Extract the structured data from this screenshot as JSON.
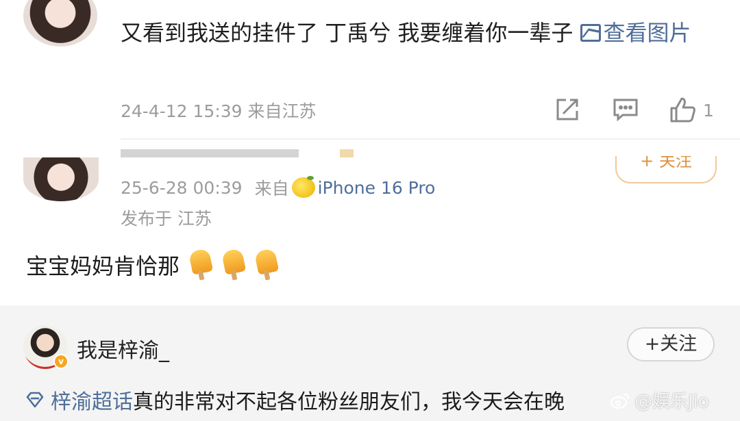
{
  "comment1": {
    "text": "又看到我送的挂件了 丁禹兮 我要缠着你一辈子 ",
    "view_image_label": "查看图片",
    "meta": "24-4-12 15:39  来自江苏",
    "like_count": "1",
    "icons": [
      "share-icon",
      "comment-icon",
      "like-icon",
      "image-icon"
    ]
  },
  "post2": {
    "follow_label": "+ 关注",
    "time": "25-6-28 00:39",
    "source_prefix": "来自",
    "device": "iPhone 16 Pro",
    "location": "发布于 江苏",
    "text": "宝宝妈妈肯恰那",
    "emoji_count": 3
  },
  "post3": {
    "username": "我是梓渝_",
    "follow_label": "+关注",
    "topic": "梓渝超话",
    "text": " 真的非常对不起各位粉丝朋友们，我今天会在晚"
  },
  "watermark": {
    "text": "@娱乐Jio"
  },
  "colors": {
    "link": "#4f6e98",
    "meta": "#9c9c9c",
    "section_bg": "#f4f4f4"
  }
}
